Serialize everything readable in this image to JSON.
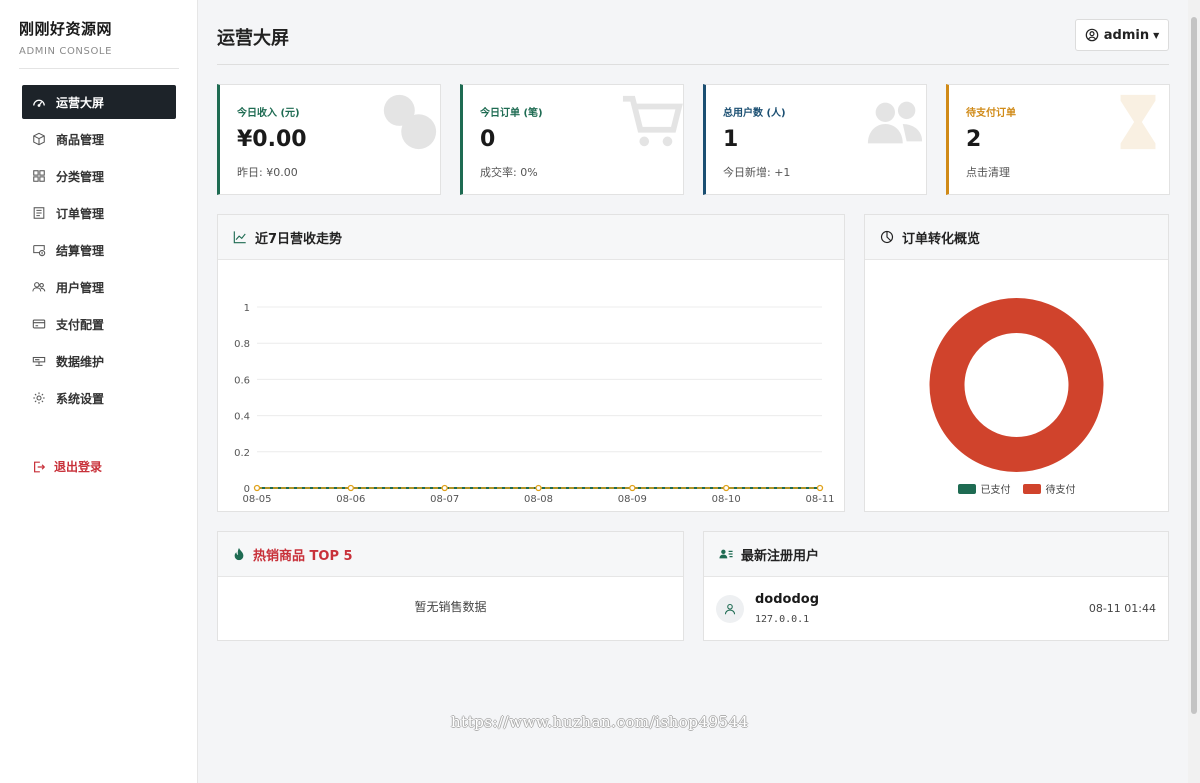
{
  "brand": {
    "title": "刚刚好资源网",
    "subtitle": "ADMIN CONSOLE"
  },
  "nav": {
    "items": [
      {
        "label": "运营大屏",
        "icon": "gauge-icon",
        "active": true
      },
      {
        "label": "商品管理",
        "icon": "box-icon"
      },
      {
        "label": "分类管理",
        "icon": "grid-icon"
      },
      {
        "label": "订单管理",
        "icon": "receipt-icon"
      },
      {
        "label": "结算管理",
        "icon": "settlement-icon"
      },
      {
        "label": "用户管理",
        "icon": "users-icon"
      },
      {
        "label": "支付配置",
        "icon": "credit-card-icon"
      },
      {
        "label": "数据维护",
        "icon": "hdd-icon"
      },
      {
        "label": "系统设置",
        "icon": "gear-icon"
      }
    ],
    "logout": "退出登录"
  },
  "header": {
    "title": "运营大屏",
    "user": "admin"
  },
  "stats": [
    {
      "label": "今日收入 (元)",
      "value": "¥0.00",
      "sub": "昨日: ¥0.00",
      "color": "#1e6b52",
      "icon": "currency-exchange-icon"
    },
    {
      "label": "今日订单 (笔)",
      "value": "0",
      "sub": "成交率: 0%",
      "color": "#1e6b52",
      "icon": "cart-check-icon"
    },
    {
      "label": "总用户数 (人)",
      "value": "1",
      "sub": "今日新增: +1",
      "color": "#1b4f72",
      "icon": "people-icon"
    },
    {
      "label": "待支付订单",
      "value": "2",
      "sub": "点击清理",
      "color": "#d08a17",
      "icon": "hourglass-icon"
    }
  ],
  "trend": {
    "title": "近7日营收走势",
    "chart_data": {
      "type": "line",
      "x": [
        "08-05",
        "08-06",
        "08-07",
        "08-08",
        "08-09",
        "08-10",
        "08-11"
      ],
      "series": [
        {
          "values": [
            0,
            0,
            0,
            0,
            0,
            0,
            0
          ],
          "color": "#1e6b52"
        },
        {
          "values": [
            0,
            0,
            0,
            0,
            0,
            0,
            0
          ],
          "color": "#e0a21b"
        }
      ],
      "ylim": [
        0,
        1
      ],
      "yticks": [
        "0",
        "0.2",
        "0.4",
        "0.6",
        "0.8",
        "1"
      ],
      "grid": true
    }
  },
  "conversion": {
    "title": "订单转化概览",
    "chart_data": {
      "type": "pie",
      "donut": true,
      "labels": [
        "已支付",
        "待支付"
      ],
      "values": [
        0,
        2
      ],
      "colors": [
        "#1e6b52",
        "#d0432c"
      ],
      "legend": "bottom"
    }
  },
  "hot": {
    "title": "热销商品 TOP 5",
    "empty": "暂无销售数据",
    "color": "#c8313a"
  },
  "recent": {
    "title": "最新注册用户",
    "users": [
      {
        "name": "dododog",
        "ip": "127.0.0.1",
        "time": "08-11 01:44"
      }
    ]
  },
  "watermark": "https://www.huzhan.com/ishop49544"
}
